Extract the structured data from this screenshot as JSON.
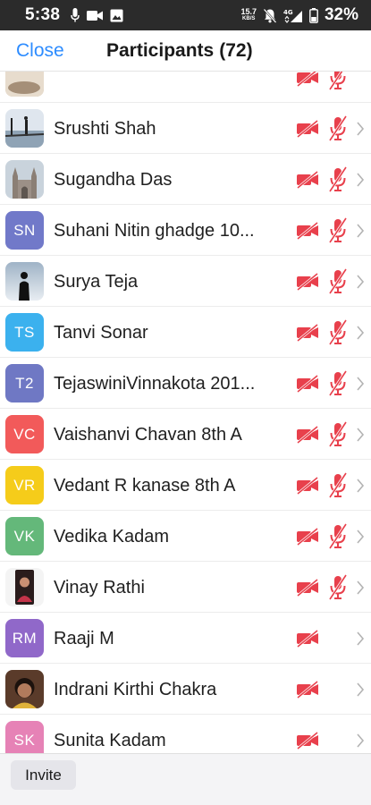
{
  "status_bar": {
    "time": "5:38",
    "speed_value": "15.7",
    "speed_unit": "KB/S",
    "network_label": "4G",
    "battery_percent": "32%"
  },
  "header": {
    "close_label": "Close",
    "title": "Participants",
    "count": "(72)"
  },
  "participants": [
    {
      "name": "Srushti Shah",
      "initials": "",
      "avatar_type": "photo-pier",
      "video": "off",
      "audio": "muted"
    },
    {
      "name": "Sugandha Das",
      "initials": "",
      "avatar_type": "photo-cathedral",
      "video": "off",
      "audio": "muted"
    },
    {
      "name": "Suhani Nitin ghadge 10...",
      "initials": "SN",
      "avatar_color": "#7179c9",
      "video": "off",
      "audio": "muted"
    },
    {
      "name": "Surya Teja",
      "initials": "",
      "avatar_type": "photo-silhouette",
      "video": "off",
      "audio": "muted"
    },
    {
      "name": "Tanvi Sonar",
      "initials": "TS",
      "avatar_color": "#3bb1ee",
      "video": "off",
      "audio": "muted"
    },
    {
      "name": "TejaswiniVinnakota 201...",
      "initials": "T2",
      "avatar_color": "#6f78c4",
      "video": "off",
      "audio": "muted"
    },
    {
      "name": "Vaishanvi Chavan 8th A",
      "initials": "VC",
      "avatar_color": "#f25a5a",
      "video": "off",
      "audio": "muted"
    },
    {
      "name": "Vedant R kanase 8th A",
      "initials": "VR",
      "avatar_color": "#f5cc1a",
      "video": "off",
      "audio": "muted"
    },
    {
      "name": "Vedika Kadam",
      "initials": "VK",
      "avatar_color": "#64b87a",
      "video": "off",
      "audio": "muted"
    },
    {
      "name": "Vinay Rathi",
      "initials": "",
      "avatar_type": "photo-person",
      "video": "off",
      "audio": "muted"
    },
    {
      "name": "Raaji M",
      "initials": "RM",
      "avatar_color": "#9068c9",
      "video": "off",
      "audio": "none"
    },
    {
      "name": "Indrani Kirthi Chakra",
      "initials": "",
      "avatar_type": "photo-child",
      "video": "off",
      "audio": "none"
    },
    {
      "name": "Sunita Kadam",
      "initials": "SK",
      "avatar_color": "#e682b6",
      "video": "off",
      "audio": "none"
    }
  ],
  "footer": {
    "invite_label": "Invite"
  },
  "colors": {
    "accent_blue": "#2d8cff",
    "muted_red": "#e8404c"
  }
}
